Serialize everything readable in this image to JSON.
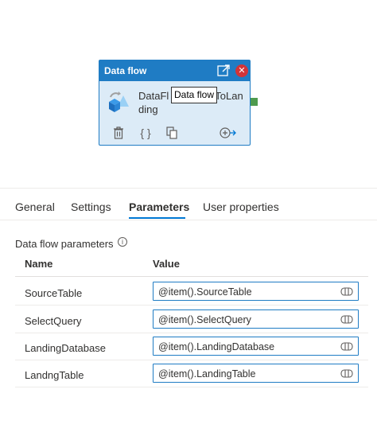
{
  "activity": {
    "header_title": "Data flow",
    "name_line1": "DataFl",
    "name_line1_tail": "ToLan",
    "name_line2": "ding",
    "tooltip": "Data flow"
  },
  "tabs": [
    {
      "label": "General"
    },
    {
      "label": "Settings"
    },
    {
      "label": "Parameters",
      "active": true
    },
    {
      "label": "User properties"
    }
  ],
  "parameters": {
    "section_title": "Data flow parameters",
    "columns": {
      "name": "Name",
      "value": "Value"
    },
    "rows": [
      {
        "name": "SourceTable",
        "value": "@item().SourceTable"
      },
      {
        "name": "SelectQuery",
        "value": "@item().SelectQuery"
      },
      {
        "name": "LandingDatabase",
        "value": "@item().LandingDatabase"
      },
      {
        "name": "LandngTable",
        "value": "@item().LandingTable"
      }
    ]
  },
  "colors": {
    "accent": "#1f7cc4",
    "close": "#d13438",
    "port": "#4e9a4e",
    "activity_bg": "#dcebf7"
  },
  "icons": [
    "open-in-new-icon",
    "close-icon",
    "dataflow-icon",
    "delete-icon",
    "code-icon",
    "copy-icon",
    "add-output-icon",
    "info-icon",
    "expression-icon"
  ]
}
